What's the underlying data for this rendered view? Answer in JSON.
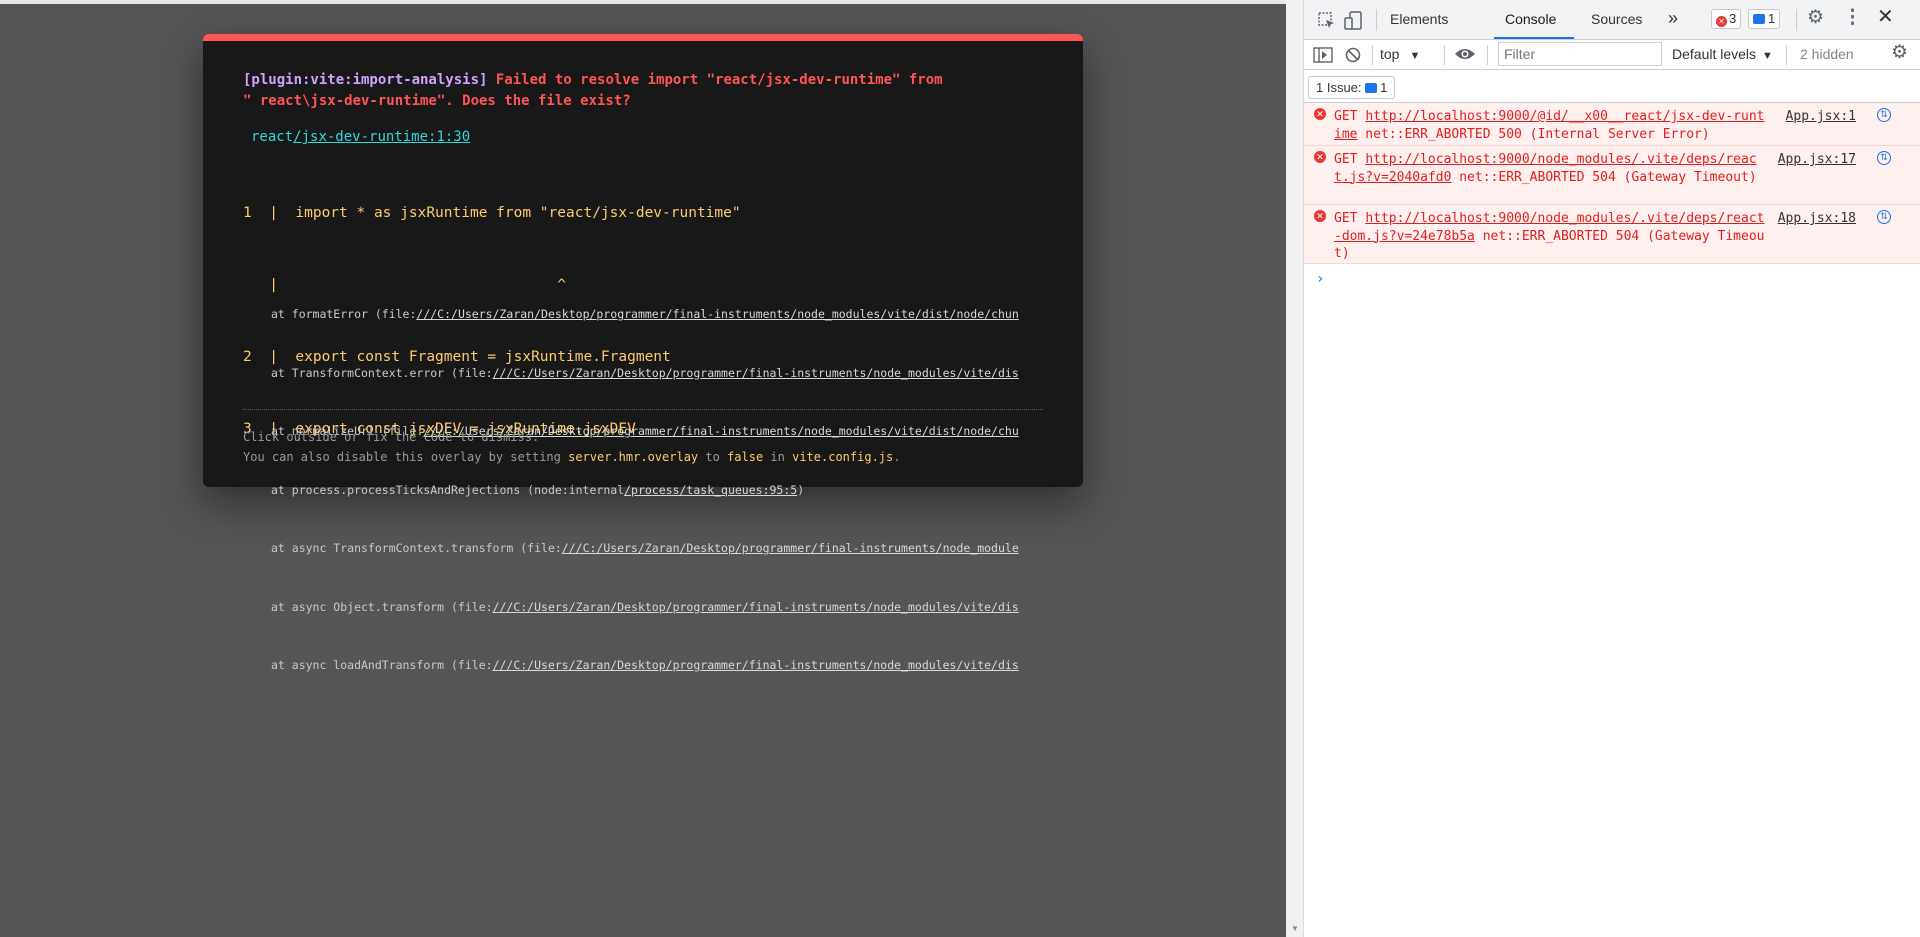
{
  "overlay": {
    "plugin": "[plugin:vite:import-analysis]",
    "message": " Failed to resolve import \"react/jsx-dev-runtime\" from\n\" react\\jsx-dev-runtime\". Does the file exist?",
    "file_prefix": "react",
    "file_link": "/jsx-dev-runtime:1:30",
    "frame": [
      "1  |  import * as jsxRuntime from \"react/jsx-dev-runtime\"",
      "   |                                ^",
      "2  |  export const Fragment = jsxRuntime.Fragment",
      "3  |  export const jsxDEV = jsxRuntime.jsxDEV"
    ],
    "stack": [
      {
        "prefix": "at formatError (file:",
        "link": "///C:/Users/Zaran/Desktop/programmer/final-instruments/node_modules/vite/dist/node/chun"
      },
      {
        "prefix": "at TransformContext.error (file:",
        "link": "///C:/Users/Zaran/Desktop/programmer/final-instruments/node_modules/vite/dis"
      },
      {
        "prefix": "at normalizeUrl (file:",
        "link": "///C:/Users/Zaran/Desktop/programmer/final-instruments/node_modules/vite/dist/node/chu"
      },
      {
        "prefix": "at process.processTicksAndRejections (node:internal",
        "link": "/process/task_queues:95:5",
        "suffix": ")"
      },
      {
        "prefix": "at async TransformContext.transform (file:",
        "link": "///C:/Users/Zaran/Desktop/programmer/final-instruments/node_module"
      },
      {
        "prefix": "at async Object.transform (file:",
        "link": "///C:/Users/Zaran/Desktop/programmer/final-instruments/node_modules/vite/dis"
      },
      {
        "prefix": "at async loadAndTransform (file:",
        "link": "///C:/Users/Zaran/Desktop/programmer/final-instruments/node_modules/vite/dis"
      }
    ],
    "tip_line1": "Click outside or fix the code to dismiss.",
    "tip_line2_a": "You can also disable this overlay by setting ",
    "tip_line2_code1": "server.hmr.overlay",
    "tip_line2_b": " to ",
    "tip_line2_code2": "false",
    "tip_line2_c": " in ",
    "tip_line2_code3": "vite.config.js",
    "tip_line2_d": ".",
    "accent_color": "#ff5555"
  },
  "devtools": {
    "tabs": [
      "Elements",
      "Console",
      "Sources"
    ],
    "active_tab": "Console",
    "more_tabs": "»",
    "error_count": "3",
    "message_count": "1",
    "context": "top",
    "filter_placeholder": "Filter",
    "levels": "Default levels",
    "hidden": "2 hidden",
    "issues_label": "1 Issue:",
    "issues_count": "1",
    "messages": [
      {
        "method": "GET",
        "url": "http://localhost:9000/@id/__x00__react/jsx-dev-runtime",
        "status": " net::ERR_ABORTED 500 (Internal Server Error)",
        "source": "App.jsx:1"
      },
      {
        "method": "GET",
        "url": "http://localhost:9000/node_modules/.vite/deps/react.js?v=2040afd0",
        "status": " net::ERR_ABORTED 504 (Gateway Timeout)",
        "source": "App.jsx:17"
      },
      {
        "method": "GET",
        "url": "http://localhost:9000/node_modules/.vite/deps/react-dom.js?v=24e78b5a",
        "status": " net::ERR_ABORTED 504 (Gateway Timeout)",
        "source": "App.jsx:18"
      }
    ],
    "error_color": "#e01e1e",
    "link_color": "#1a73e8"
  }
}
